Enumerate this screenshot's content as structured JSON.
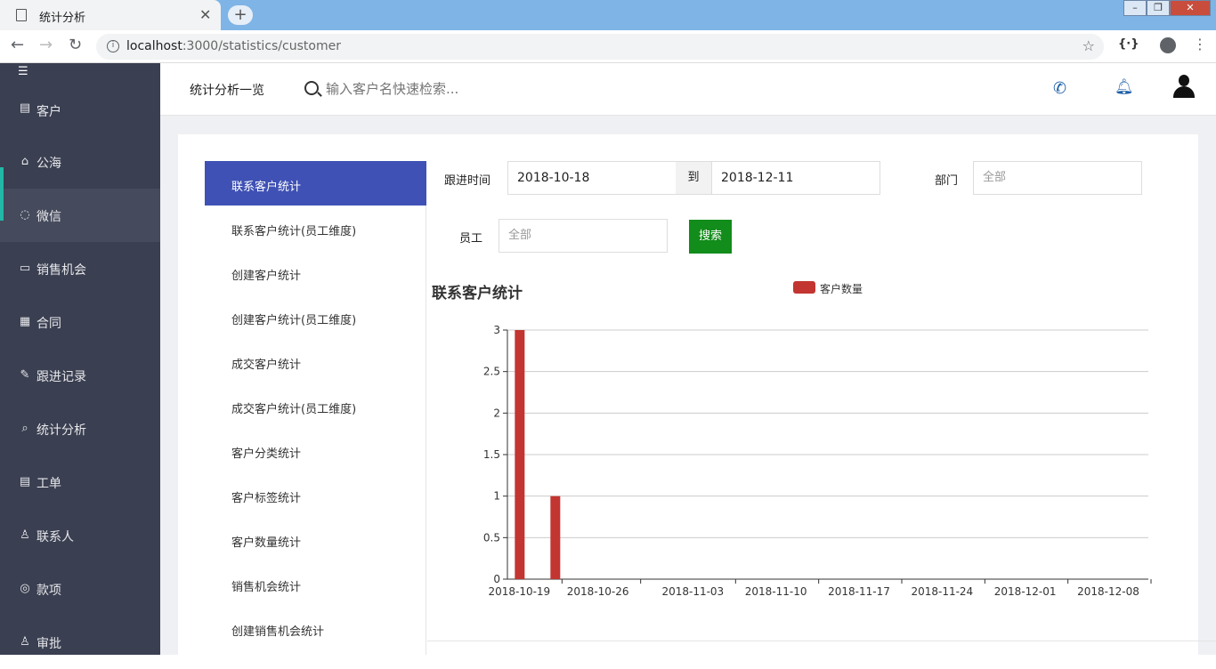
{
  "browser": {
    "tab_title": "统计分析",
    "url_host": "localhost",
    "url_path": ":3000/statistics/customer",
    "ext_label": "{·}"
  },
  "sidebar": {
    "items": [
      {
        "label": "客户",
        "icon": "doc-icon"
      },
      {
        "label": "公海",
        "icon": "basket-icon"
      },
      {
        "label": "微信",
        "icon": "wechat-icon"
      },
      {
        "label": "销售机会",
        "icon": "briefcase-icon"
      },
      {
        "label": "合同",
        "icon": "contract-icon"
      },
      {
        "label": "跟进记录",
        "icon": "edit-icon"
      },
      {
        "label": "统计分析",
        "icon": "search-icon"
      },
      {
        "label": "工单",
        "icon": "ticket-icon"
      },
      {
        "label": "联系人",
        "icon": "person-icon"
      },
      {
        "label": "款项",
        "icon": "money-icon"
      },
      {
        "label": "审批",
        "icon": "approve-icon"
      }
    ]
  },
  "topbar": {
    "title": "统计分析一览",
    "search_placeholder": "输入客户名快速检索..."
  },
  "stat_menu": [
    "联系客户统计",
    "联系客户统计(员工维度)",
    "创建客户统计",
    "创建客户统计(员工维度)",
    "成交客户统计",
    "成交客户统计(员工维度)",
    "客户分类统计",
    "客户标签统计",
    "客户数量统计",
    "销售机会统计",
    "创建销售机会统计"
  ],
  "filters": {
    "follow_time_label": "跟进时间",
    "date_from": "2018-10-18",
    "to_label": "到",
    "date_to": "2018-12-11",
    "dept_label": "部门",
    "dept_value": "全部",
    "staff_label": "员工",
    "staff_value": "全部",
    "search_button": "搜索"
  },
  "colors": {
    "accent": "#3f51b5",
    "sidebar_bg": "#3a3f51",
    "search_button": "#128c1a",
    "bar": "#c23531"
  },
  "chart_data": {
    "type": "bar",
    "title": "联系客户统计",
    "legend": [
      "客户数量"
    ],
    "legend_position": "top-center",
    "x_tick_labels": [
      "2018-10-19",
      "2018-10-26",
      "2018-11-03",
      "2018-11-10",
      "2018-11-17",
      "2018-11-24",
      "2018-12-01",
      "2018-12-08"
    ],
    "x_range": [
      "2018-10-18",
      "2018-12-11"
    ],
    "series": [
      {
        "name": "客户数量",
        "points": [
          {
            "x": "2018-10-19",
            "y": 3
          },
          {
            "x": "2018-10-22",
            "y": 1
          }
        ]
      }
    ],
    "y_ticks": [
      "0",
      "0.5",
      "1",
      "1.5",
      "2",
      "2.5",
      "3"
    ],
    "ylim": [
      0,
      3
    ],
    "grid": true
  }
}
